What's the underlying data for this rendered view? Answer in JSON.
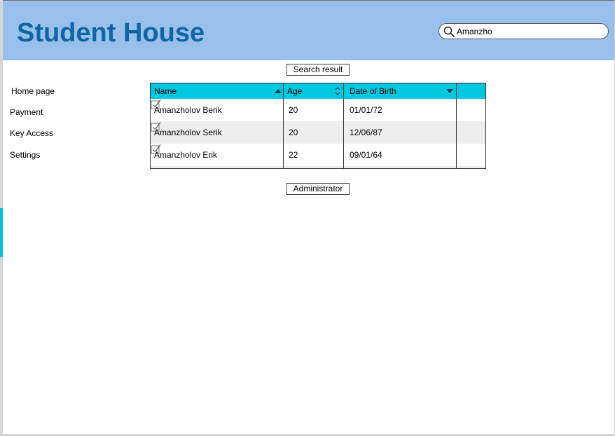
{
  "header": {
    "title": "Student House",
    "search": {
      "value": "Amanzho",
      "icon": "search-icon"
    }
  },
  "buttons": {
    "search_result": "Search result",
    "administrator": "Administrator"
  },
  "nav": {
    "items": [
      {
        "label": "Home page"
      },
      {
        "label": "Payment"
      },
      {
        "label": "Key Access"
      },
      {
        "label": "Settings"
      }
    ]
  },
  "table": {
    "columns": [
      "Name",
      "Age",
      "Date of Birth",
      ""
    ],
    "rows": [
      {
        "name": "Amanzholov Berik",
        "age": "20",
        "dob": "01/01/72",
        "checked": true
      },
      {
        "name": "Amanzholov Serik",
        "age": "20",
        "dob": "12/06/87",
        "checked": true
      },
      {
        "name": "Amanzholov Erik",
        "age": "22",
        "dob": "09/01/64",
        "checked": true
      }
    ]
  },
  "colors": {
    "header_bg": "#99bfed",
    "title": "#0f66a3",
    "table_header": "#00c8df",
    "accent": "#00c4dc"
  }
}
